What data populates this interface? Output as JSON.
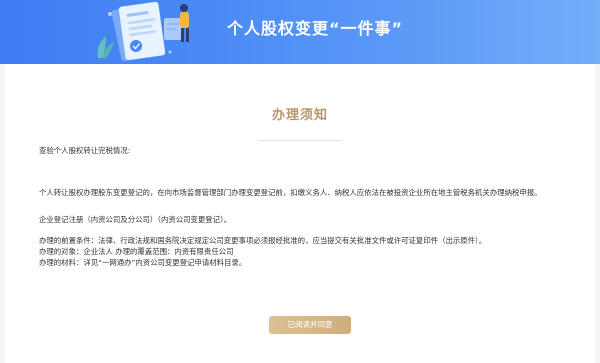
{
  "header": {
    "title": "个人股权变更“一件事”"
  },
  "notice": {
    "title": "办理须知",
    "lines": [
      "查验个人股权转让完税情况:",
      "个人转让股权办理股东变更登记的，在向市场监督管理部门办理变更登记前，扣缴义务人、纳税人应依法在被投资企业所在地主管税务机关办理纳税申报。",
      "企业登记注册（内资公司及分公司）（内资公司变更登记）。",
      "办理的前置条件：法律、行政法规和国务院决定规定公司变更事项必须报经批准的，应当提交有关批准文件或许可证复印件（出示原件）。",
      "办理的对象：企业法人 办理的覆盖范围：内资有限责任公司",
      "办理的材料：详见“一网通办”内资公司变更登记申请材料目录。"
    ]
  },
  "actions": {
    "agree_label": "已阅读并同意"
  },
  "colors": {
    "banner_blue": "#3d7df2",
    "accent_gold": "#b8956a",
    "button_gold": "#d4b584"
  }
}
